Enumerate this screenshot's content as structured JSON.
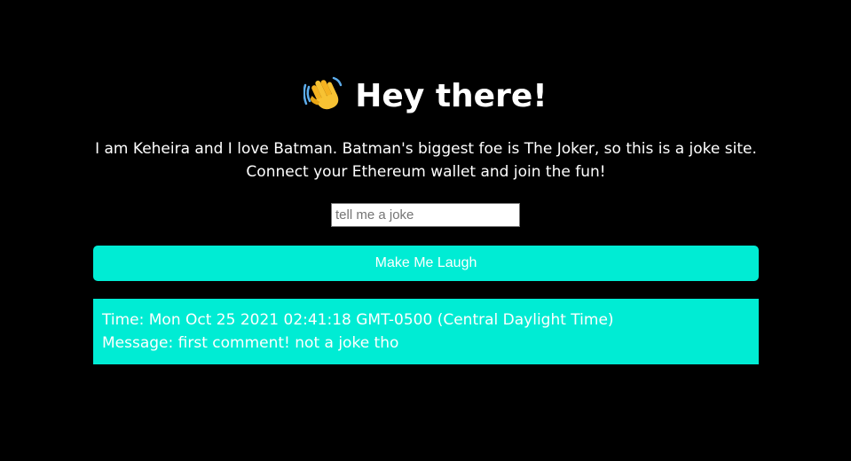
{
  "header": {
    "icon": "waving-hand-icon",
    "title": "Hey there!"
  },
  "bio": {
    "text": "I am Keheira and I love Batman. Batman's biggest foe is The Joker, so this is a joke site. Connect your Ethereum wallet and join the fun!"
  },
  "joke_form": {
    "placeholder": "tell me a joke",
    "value": "",
    "submit_label": "Make Me Laugh"
  },
  "jokes": [
    {
      "time_label": "Time:",
      "time": "Mon Oct 25 2021 02:41:18 GMT-0500 (Central Daylight Time)",
      "message_label": "Message:",
      "message": "first comment! not a joke tho"
    }
  ],
  "colors": {
    "background": "#000000",
    "accent": "#00ecd4",
    "text": "#ffffff"
  }
}
